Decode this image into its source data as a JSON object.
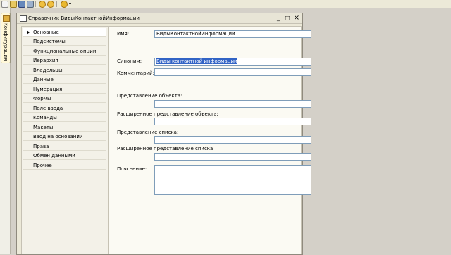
{
  "toolbar": {
    "icons": [
      "new-document-icon",
      "open-icon",
      "save-icon",
      "separator",
      "run-icon",
      "forward-icon",
      "help-icon"
    ]
  },
  "sidebar_tab": {
    "label": "Конфигурация"
  },
  "window": {
    "title": "Справочник ВидыКонтактнойИнформации",
    "buttons": {
      "minimize": "_",
      "maximize": "□",
      "close": "×"
    }
  },
  "nav": {
    "items": [
      "Основные",
      "Подсистемы",
      "Функциональные опции",
      "Иерархия",
      "Владельцы",
      "Данные",
      "Нумерация",
      "Формы",
      "Поле ввода",
      "Команды",
      "Макеты",
      "Ввод на основании",
      "Права",
      "Обмен данными",
      "Прочее"
    ],
    "selected": "Основные"
  },
  "form": {
    "name_label": "Имя:",
    "name_value": "ВидыКонтактнойИнформации",
    "synonym_label": "Синоним:",
    "synonym_value": "Виды контактной информации",
    "comment_label": "Комментарий:",
    "comment_value": "",
    "object_repr_label": "Представление объекта:",
    "object_repr_value": "",
    "ext_object_repr_label": "Расширенное представление объекта:",
    "ext_object_repr_value": "",
    "list_repr_label": "Представление списка:",
    "list_repr_value": "",
    "ext_list_repr_label": "Расширенное представление списка:",
    "ext_list_repr_value": "",
    "explanation_label": "Пояснение:",
    "explanation_value": ""
  }
}
